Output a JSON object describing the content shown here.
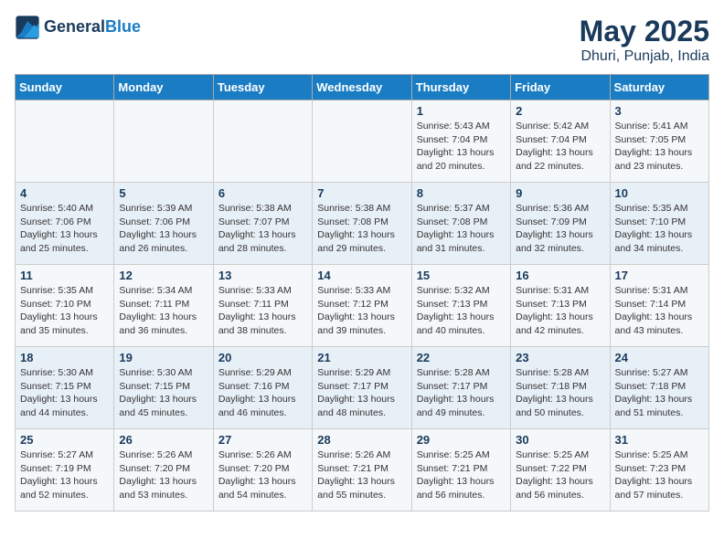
{
  "logo": {
    "line1": "General",
    "line2": "Blue"
  },
  "title": "May 2025",
  "location": "Dhuri, Punjab, India",
  "days_header": [
    "Sunday",
    "Monday",
    "Tuesday",
    "Wednesday",
    "Thursday",
    "Friday",
    "Saturday"
  ],
  "weeks": [
    [
      {
        "day": "",
        "info": ""
      },
      {
        "day": "",
        "info": ""
      },
      {
        "day": "",
        "info": ""
      },
      {
        "day": "",
        "info": ""
      },
      {
        "day": "1",
        "info": "Sunrise: 5:43 AM\nSunset: 7:04 PM\nDaylight: 13 hours\nand 20 minutes."
      },
      {
        "day": "2",
        "info": "Sunrise: 5:42 AM\nSunset: 7:04 PM\nDaylight: 13 hours\nand 22 minutes."
      },
      {
        "day": "3",
        "info": "Sunrise: 5:41 AM\nSunset: 7:05 PM\nDaylight: 13 hours\nand 23 minutes."
      }
    ],
    [
      {
        "day": "4",
        "info": "Sunrise: 5:40 AM\nSunset: 7:06 PM\nDaylight: 13 hours\nand 25 minutes."
      },
      {
        "day": "5",
        "info": "Sunrise: 5:39 AM\nSunset: 7:06 PM\nDaylight: 13 hours\nand 26 minutes."
      },
      {
        "day": "6",
        "info": "Sunrise: 5:38 AM\nSunset: 7:07 PM\nDaylight: 13 hours\nand 28 minutes."
      },
      {
        "day": "7",
        "info": "Sunrise: 5:38 AM\nSunset: 7:08 PM\nDaylight: 13 hours\nand 29 minutes."
      },
      {
        "day": "8",
        "info": "Sunrise: 5:37 AM\nSunset: 7:08 PM\nDaylight: 13 hours\nand 31 minutes."
      },
      {
        "day": "9",
        "info": "Sunrise: 5:36 AM\nSunset: 7:09 PM\nDaylight: 13 hours\nand 32 minutes."
      },
      {
        "day": "10",
        "info": "Sunrise: 5:35 AM\nSunset: 7:10 PM\nDaylight: 13 hours\nand 34 minutes."
      }
    ],
    [
      {
        "day": "11",
        "info": "Sunrise: 5:35 AM\nSunset: 7:10 PM\nDaylight: 13 hours\nand 35 minutes."
      },
      {
        "day": "12",
        "info": "Sunrise: 5:34 AM\nSunset: 7:11 PM\nDaylight: 13 hours\nand 36 minutes."
      },
      {
        "day": "13",
        "info": "Sunrise: 5:33 AM\nSunset: 7:11 PM\nDaylight: 13 hours\nand 38 minutes."
      },
      {
        "day": "14",
        "info": "Sunrise: 5:33 AM\nSunset: 7:12 PM\nDaylight: 13 hours\nand 39 minutes."
      },
      {
        "day": "15",
        "info": "Sunrise: 5:32 AM\nSunset: 7:13 PM\nDaylight: 13 hours\nand 40 minutes."
      },
      {
        "day": "16",
        "info": "Sunrise: 5:31 AM\nSunset: 7:13 PM\nDaylight: 13 hours\nand 42 minutes."
      },
      {
        "day": "17",
        "info": "Sunrise: 5:31 AM\nSunset: 7:14 PM\nDaylight: 13 hours\nand 43 minutes."
      }
    ],
    [
      {
        "day": "18",
        "info": "Sunrise: 5:30 AM\nSunset: 7:15 PM\nDaylight: 13 hours\nand 44 minutes."
      },
      {
        "day": "19",
        "info": "Sunrise: 5:30 AM\nSunset: 7:15 PM\nDaylight: 13 hours\nand 45 minutes."
      },
      {
        "day": "20",
        "info": "Sunrise: 5:29 AM\nSunset: 7:16 PM\nDaylight: 13 hours\nand 46 minutes."
      },
      {
        "day": "21",
        "info": "Sunrise: 5:29 AM\nSunset: 7:17 PM\nDaylight: 13 hours\nand 48 minutes."
      },
      {
        "day": "22",
        "info": "Sunrise: 5:28 AM\nSunset: 7:17 PM\nDaylight: 13 hours\nand 49 minutes."
      },
      {
        "day": "23",
        "info": "Sunrise: 5:28 AM\nSunset: 7:18 PM\nDaylight: 13 hours\nand 50 minutes."
      },
      {
        "day": "24",
        "info": "Sunrise: 5:27 AM\nSunset: 7:18 PM\nDaylight: 13 hours\nand 51 minutes."
      }
    ],
    [
      {
        "day": "25",
        "info": "Sunrise: 5:27 AM\nSunset: 7:19 PM\nDaylight: 13 hours\nand 52 minutes."
      },
      {
        "day": "26",
        "info": "Sunrise: 5:26 AM\nSunset: 7:20 PM\nDaylight: 13 hours\nand 53 minutes."
      },
      {
        "day": "27",
        "info": "Sunrise: 5:26 AM\nSunset: 7:20 PM\nDaylight: 13 hours\nand 54 minutes."
      },
      {
        "day": "28",
        "info": "Sunrise: 5:26 AM\nSunset: 7:21 PM\nDaylight: 13 hours\nand 55 minutes."
      },
      {
        "day": "29",
        "info": "Sunrise: 5:25 AM\nSunset: 7:21 PM\nDaylight: 13 hours\nand 56 minutes."
      },
      {
        "day": "30",
        "info": "Sunrise: 5:25 AM\nSunset: 7:22 PM\nDaylight: 13 hours\nand 56 minutes."
      },
      {
        "day": "31",
        "info": "Sunrise: 5:25 AM\nSunset: 7:23 PM\nDaylight: 13 hours\nand 57 minutes."
      }
    ]
  ]
}
